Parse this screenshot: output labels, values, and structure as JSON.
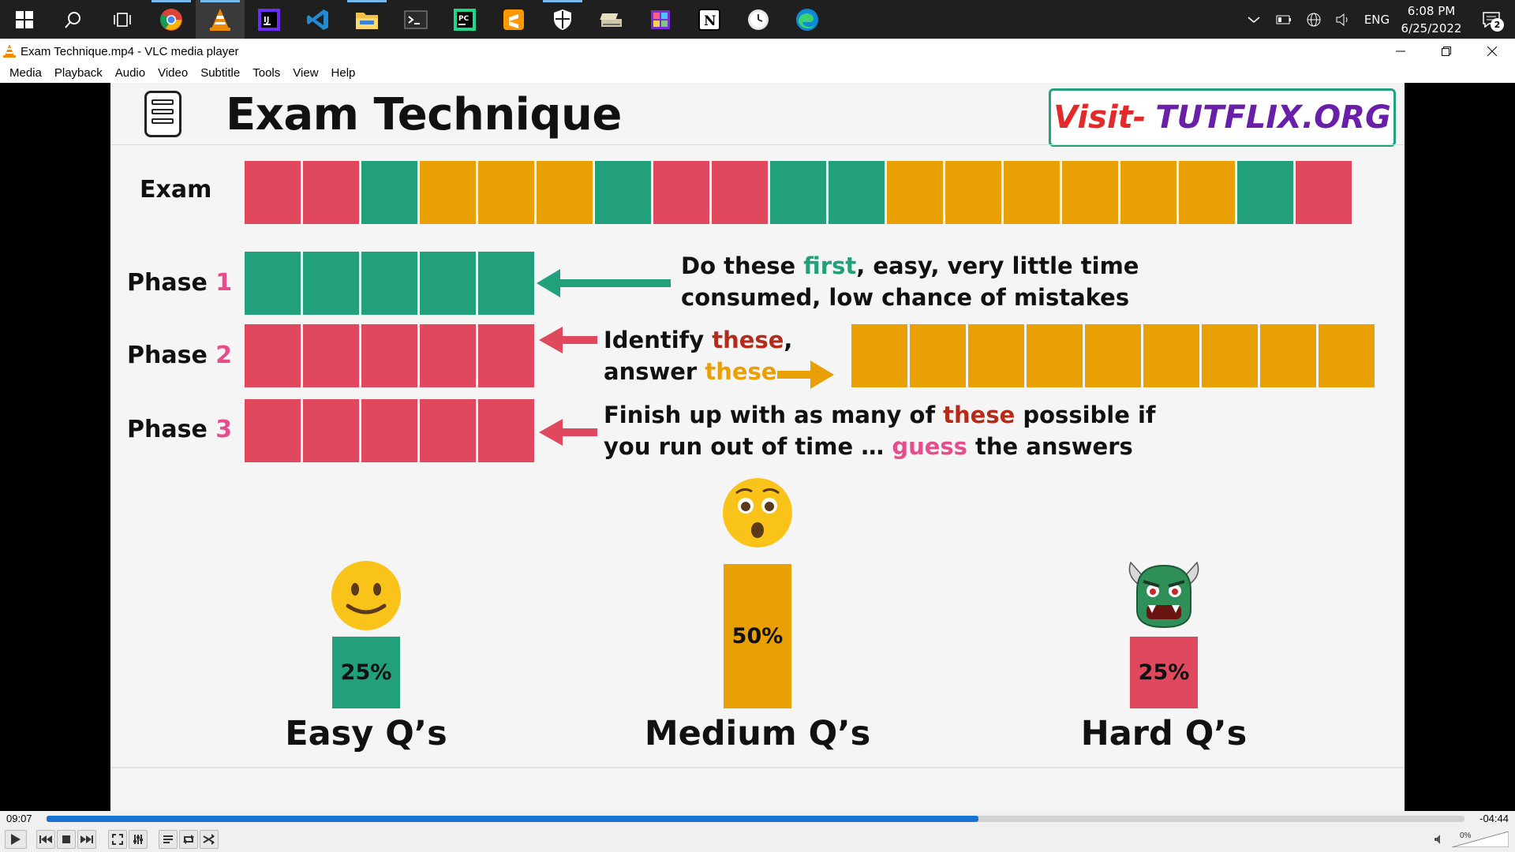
{
  "taskbar": {
    "apps": [
      "start",
      "search",
      "task-view",
      "chrome",
      "vlc",
      "intellij",
      "vscode",
      "file-explorer",
      "terminal",
      "pycharm",
      "sublime",
      "security",
      "app-1",
      "app-2",
      "notion",
      "clock-app",
      "edge"
    ],
    "tray": {
      "lang": "ENG",
      "time": "6:08 PM",
      "date": "6/25/2022",
      "notification_count": "2"
    }
  },
  "window": {
    "title": "Exam Technique.mp4 - VLC media player"
  },
  "menu": {
    "items": [
      "Media",
      "Playback",
      "Audio",
      "Video",
      "Subtitle",
      "Tools",
      "View",
      "Help"
    ]
  },
  "slide": {
    "heading": "Exam Technique",
    "visit": {
      "prefix": "Visit-",
      "site": "TUTFLIX.ORG"
    },
    "exam_label": "Exam",
    "exam_blocks": [
      "r",
      "r",
      "g",
      "o",
      "o",
      "o",
      "g",
      "r",
      "r",
      "g",
      "g",
      "o",
      "o",
      "o",
      "o",
      "o",
      "o",
      "g",
      "r"
    ],
    "phase_word": "Phase",
    "phases": [
      {
        "num": "1",
        "color": "g"
      },
      {
        "num": "2",
        "color": "r"
      },
      {
        "num": "3",
        "color": "r"
      }
    ],
    "phase1_note": {
      "l1_a": "Do these ",
      "l1_b": "first",
      "l1_c": ", easy, very little time",
      "l2": "consumed, low chance of mistakes"
    },
    "phase2_note": {
      "l1_a": "Identify ",
      "l1_b": "these",
      "l1_c": ",",
      "l2_a": "answer ",
      "l2_b": "these"
    },
    "phase3_note": {
      "l1_a": "Finish up with as many of ",
      "l1_b": "these",
      "l1_c": " possible if",
      "l2_a": "you run out of time … ",
      "l2_b": "guess",
      "l2_c": " the answers"
    },
    "categories": [
      {
        "label": "Easy Q’s",
        "pct": "25%",
        "value": 25,
        "color": "#22a07b",
        "emoji": "slightly-smiling"
      },
      {
        "label": "Medium Q’s",
        "pct": "50%",
        "value": 50,
        "color": "#e9a004",
        "emoji": "astonished"
      },
      {
        "label": "Hard Q’s",
        "pct": "25%",
        "value": 25,
        "color": "#df485d",
        "emoji": "ogre"
      }
    ],
    "colors": {
      "green": "#22a07b",
      "red": "#df485d",
      "orange": "#e9a004",
      "pink": "#e54e8d",
      "dark_red": "#b52b19",
      "purple": "#6a1fa8"
    }
  },
  "player": {
    "elapsed": "09:07",
    "remaining": "-04:44",
    "progress": 0.657,
    "volume": "0%"
  }
}
